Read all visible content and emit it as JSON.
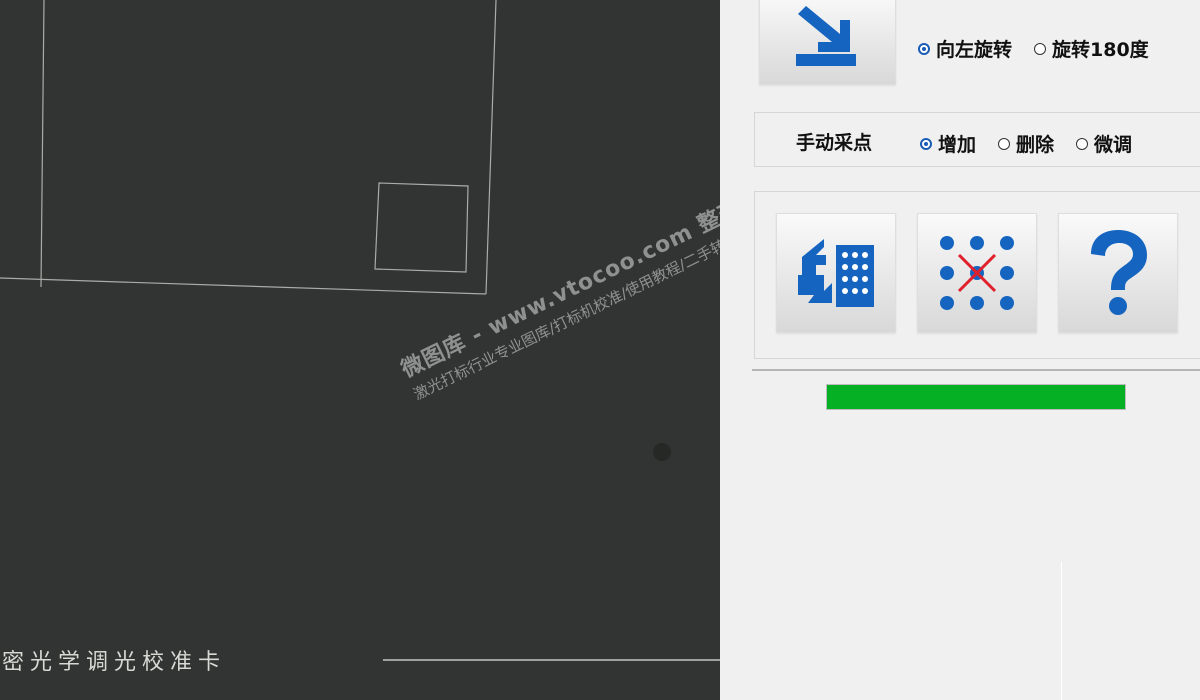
{
  "scan": {
    "caption": "密光学调光校准卡"
  },
  "watermark": {
    "line1": "微图库 - www.vtocoo.com 整理分享",
    "line2": "激光打标行业专业图库/打标机校准/使用教程/二手转让"
  },
  "rotation": {
    "options": [
      {
        "label": "向左旋转",
        "selected": true
      },
      {
        "label": "旋转180度",
        "selected": false
      }
    ]
  },
  "manual": {
    "label": "手动采点",
    "options": [
      {
        "label": "增加",
        "selected": true
      },
      {
        "label": "删除",
        "selected": false
      },
      {
        "label": "微调",
        "selected": false
      }
    ]
  },
  "tools": {
    "icons": [
      "rotate-arrow-grid-icon",
      "dot-grid-cross-icon",
      "help-question-icon"
    ]
  },
  "progress": {
    "value": 1.0,
    "color": "#06b025"
  },
  "colors": {
    "accent": "#1a5cb5",
    "icon_blue": "#1565c0",
    "cross_red": "#e0202a"
  }
}
